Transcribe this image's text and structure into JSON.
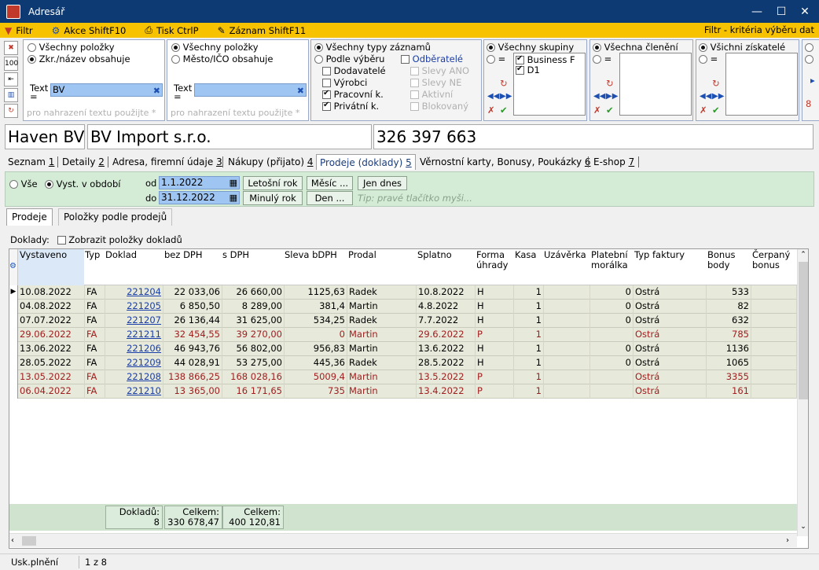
{
  "window": {
    "title": "Adresář"
  },
  "toolbar": {
    "filter": "Filtr",
    "actions": "Akce ShiftF10",
    "print": "Tisk CtrlP",
    "record": "Záznam ShiftF11",
    "right": "Filtr - kritéria výběru dat"
  },
  "left_icons": {
    "hundred": "100"
  },
  "filter1": {
    "opt_all": "Všechny položky",
    "opt_name": "Zkr./název obsahuje",
    "text_label": "Text =",
    "text_value": "BV",
    "hint": "pro nahrazení textu použijte *"
  },
  "filter2": {
    "opt_all": "Všechny položky",
    "opt_city": "Město/IČO obsahuje",
    "text_label": "Text =",
    "text_value": "",
    "hint": "pro nahrazení textu použijte *"
  },
  "filter3": {
    "opt_all": "Všechny typy záznamů",
    "opt_select": "Podle výběru",
    "customers": "Odběratelé",
    "suppliers": "Dodavatelé",
    "producers": "Výrobci",
    "workers": "Pracovní k.",
    "private": "Privátní k.",
    "disc_yes": "Slevy ANO",
    "disc_no": "Slevy NE",
    "active": "Aktivní",
    "blocked": "Blokovaný"
  },
  "filter4": {
    "opt_all": "Všechny skupiny",
    "eq": "=",
    "items": [
      "Business F",
      "D1"
    ]
  },
  "filter5": {
    "opt_all": "Všechna členění",
    "eq": "="
  },
  "filter6": {
    "opt_all": "Všichni získatelé",
    "eq": "="
  },
  "filter7": {
    "digit": "8"
  },
  "info": {
    "short": "Haven BV",
    "name": "BV Import s.r.o.",
    "phone": "326 397 663"
  },
  "tabs": [
    {
      "label": "Seznam",
      "key": "1"
    },
    {
      "label": "Detaily",
      "key": "2"
    },
    {
      "label": "Adresa, firemní údaje",
      "key": "3"
    },
    {
      "label": "Nákupy (přijato)",
      "key": "4"
    },
    {
      "label": "Prodeje (doklady)",
      "key": "5"
    },
    {
      "label": "Věrnostní karty, Bonusy, Poukázky",
      "key": "6"
    },
    {
      "label": "E-shop",
      "key": "7"
    }
  ],
  "period": {
    "all": "Vše",
    "in_period": "Vyst. v období",
    "from_label": "od",
    "from": "1.1.2022",
    "to_label": "do",
    "to": "31.12.2022",
    "this_year": "Letošní rok",
    "last_year": "Minulý rok",
    "month": "Měsíc ...",
    "day": "Den ...",
    "today": "Jen dnes",
    "tip": "Tip: pravé tlačítko myši..."
  },
  "subtabs": {
    "sales": "Prodeje",
    "items": "Položky podle prodejů"
  },
  "docs": {
    "label": "Doklady:",
    "show_items": "Zobrazit položky dokladů"
  },
  "table": {
    "headers": [
      "Vystaveno",
      "Typ",
      "Doklad",
      "bez DPH",
      "s DPH",
      "Sleva bDPH",
      "Prodal",
      "Splatno",
      "Forma úhrady",
      "Kasa",
      "Uzávěrka",
      "Platební morálka",
      "Typ faktury",
      "Bonus body",
      "Čerpaný bonus"
    ],
    "rows": [
      {
        "date": "10.08.2022",
        "type": "FA",
        "doc": "221204",
        "net": "22 033,06",
        "gross": "26 660,00",
        "disc": "1125,63",
        "seller": "Radek",
        "due": "10.8.2022",
        "pay": "H",
        "kasa": "1",
        "close": "",
        "moral": "0",
        "inv": "Ostrá",
        "bonus": "533",
        "red": false
      },
      {
        "date": "04.08.2022",
        "type": "FA",
        "doc": "221205",
        "net": "6 850,50",
        "gross": "8 289,00",
        "disc": "381,4",
        "seller": "Martin",
        "due": "4.8.2022",
        "pay": "H",
        "kasa": "1",
        "close": "",
        "moral": "0",
        "inv": "Ostrá",
        "bonus": "82",
        "red": false
      },
      {
        "date": "07.07.2022",
        "type": "FA",
        "doc": "221207",
        "net": "26 136,44",
        "gross": "31 625,00",
        "disc": "534,25",
        "seller": "Radek",
        "due": "7.7.2022",
        "pay": "H",
        "kasa": "1",
        "close": "",
        "moral": "0",
        "inv": "Ostrá",
        "bonus": "632",
        "red": false
      },
      {
        "date": "29.06.2022",
        "type": "FA",
        "doc": "221211",
        "net": "32 454,55",
        "gross": "39 270,00",
        "disc": "0",
        "seller": "Martin",
        "due": "29.6.2022",
        "pay": "P",
        "kasa": "1",
        "close": "",
        "moral": "",
        "inv": "Ostrá",
        "bonus": "785",
        "red": true
      },
      {
        "date": "13.06.2022",
        "type": "FA",
        "doc": "221206",
        "net": "46 943,76",
        "gross": "56 802,00",
        "disc": "956,83",
        "seller": "Martin",
        "due": "13.6.2022",
        "pay": "H",
        "kasa": "1",
        "close": "",
        "moral": "0",
        "inv": "Ostrá",
        "bonus": "1136",
        "red": false
      },
      {
        "date": "28.05.2022",
        "type": "FA",
        "doc": "221209",
        "net": "44 028,91",
        "gross": "53 275,00",
        "disc": "445,36",
        "seller": "Radek",
        "due": "28.5.2022",
        "pay": "H",
        "kasa": "1",
        "close": "",
        "moral": "0",
        "inv": "Ostrá",
        "bonus": "1065",
        "red": false
      },
      {
        "date": "13.05.2022",
        "type": "FA",
        "doc": "221208",
        "net": "138 866,25",
        "gross": "168 028,16",
        "disc": "5009,4",
        "seller": "Martin",
        "due": "13.5.2022",
        "pay": "P",
        "kasa": "1",
        "close": "",
        "moral": "",
        "inv": "Ostrá",
        "bonus": "3355",
        "red": true
      },
      {
        "date": "06.04.2022",
        "type": "FA",
        "doc": "221210",
        "net": "13 365,00",
        "gross": "16 171,65",
        "disc": "735",
        "seller": "Martin",
        "due": "13.4.2022",
        "pay": "P",
        "kasa": "1",
        "close": "",
        "moral": "",
        "inv": "Ostrá",
        "bonus": "161",
        "red": true
      }
    ],
    "footer": {
      "docs_label": "Dokladů:",
      "docs_count": "8",
      "net_label": "Celkem:",
      "net_total": "330 678,47",
      "gross_label": "Celkem:",
      "gross_total": "400 120,81"
    }
  },
  "status": {
    "left": "Usk.plnění",
    "right": "1 z 8"
  },
  "colors": {
    "title_bar": "#0e3a73",
    "toolbar": "#f7c200",
    "period_bg": "#d4ebd6",
    "row_bg": "#e7e9da",
    "red_text": "#a02020"
  }
}
